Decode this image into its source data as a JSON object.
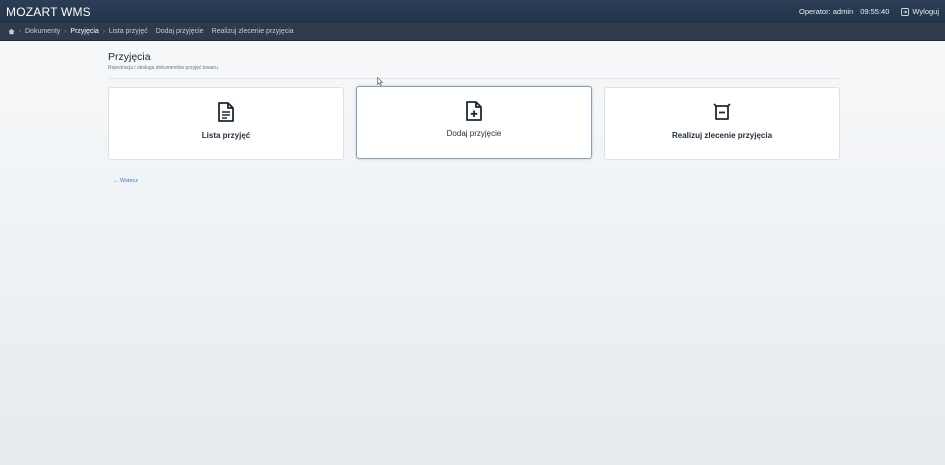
{
  "header": {
    "brand": "MOZART WMS",
    "operator": "Operator: admin",
    "time": "09:55:40",
    "logout_label": "Wyloguj"
  },
  "breadcrumb": {
    "items": [
      "Dokumenty",
      "Przyjęcia"
    ],
    "quick_links": [
      "Lista przyjęć",
      "Dodaj przyjęcie",
      "Realizuj zlecenie przyjęcia"
    ]
  },
  "page": {
    "title": "Przyjęcia",
    "subtitle": "Rejestracja i obsługa dokumentów przyjęć towaru"
  },
  "cards": [
    {
      "label": "Lista przyjęć",
      "icon": "document-list-icon"
    },
    {
      "label": "Dodaj przyjęcie",
      "icon": "document-add-icon"
    },
    {
      "label": "Realizuj zlecenie przyjęcia",
      "icon": "receive-tray-icon"
    }
  ],
  "back_label": "← Wstecz",
  "colors": {
    "topbar": "#22344a",
    "breadcrumb_bar": "#2d3b4c",
    "link": "#3d7bbf"
  }
}
